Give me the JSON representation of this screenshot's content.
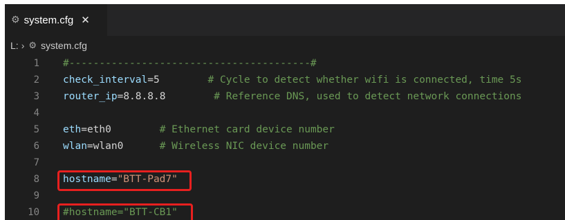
{
  "tab": {
    "label": "system.cfg",
    "close_glyph": "✕",
    "icon": "gear-icon"
  },
  "breadcrumb": {
    "drive": "L:",
    "separator": "›",
    "file": "system.cfg"
  },
  "lines": [
    {
      "n": "1",
      "comment": "#----------------------------------------#"
    },
    {
      "n": "2",
      "key": "check_interval",
      "eq": "=",
      "val": "5",
      "pad": "        ",
      "comment": "# Cycle to detect whether wifi is connected, time 5s"
    },
    {
      "n": "3",
      "key": "router_ip",
      "eq": "=",
      "val": "8.8.8.8",
      "pad": "        ",
      "comment": "# Reference DNS, used to detect network connections"
    },
    {
      "n": "4"
    },
    {
      "n": "5",
      "key": "eth",
      "eq": "=",
      "val": "eth0",
      "pad": "        ",
      "comment": "# Ethernet card device number"
    },
    {
      "n": "6",
      "key": "wlan",
      "eq": "=",
      "val": "wlan0",
      "pad": "      ",
      "comment": "# Wireless NIC device number"
    },
    {
      "n": "7"
    },
    {
      "n": "8",
      "key": "hostname",
      "eq": "=",
      "str": "\"BTT-Pad7\""
    },
    {
      "n": "9"
    },
    {
      "n": "10",
      "comment": "#hostname=\"BTT-CB1\""
    }
  ],
  "colors": {
    "highlight_box": "#e8201f",
    "comment": "#6a9955",
    "key": "#9cdcfe",
    "string": "#ce9178"
  }
}
